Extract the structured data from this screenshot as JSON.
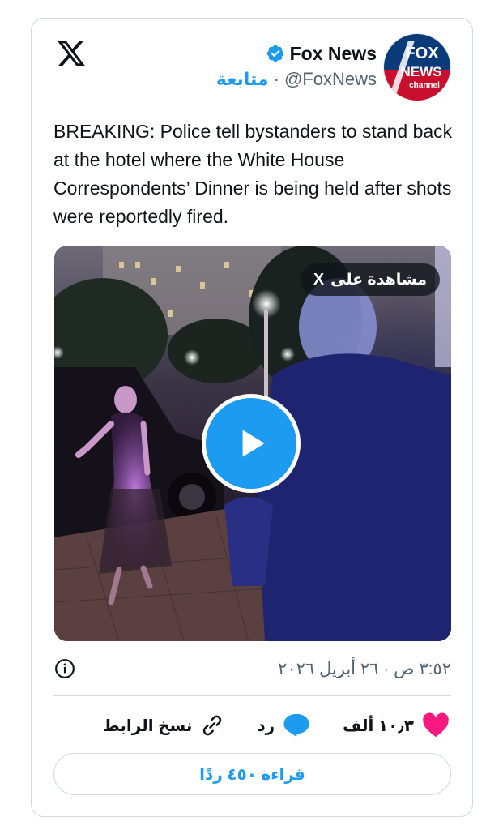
{
  "account": {
    "display_name": "Fox News",
    "handle": "@FoxNews",
    "separator": "·",
    "follow_label": "متابعة",
    "avatar_text_top": "FOX",
    "avatar_text_mid": "NEWS",
    "avatar_text_bottom": "channel"
  },
  "tweet": {
    "text": "BREAKING: Police tell bystanders to stand back at the hotel where the White House Correspondents’ Dinner is being held after shots were reportedly fired.",
    "watch_label": "مشاهدة على",
    "watch_x": "X",
    "timestamp": "٣:٥٢ ص · ٢٦ أبريل ٢٠٢٦"
  },
  "actions": {
    "likes_count": "١٠٫٣ ألف",
    "reply_label": "رد",
    "copy_link_label": "نسخ الرابط"
  },
  "read_replies_label": "قراءة ٤٥٠ ردًا",
  "colors": {
    "accent": "#1d9bf0",
    "heart": "#f91880",
    "fox_red": "#c8102e",
    "fox_blue": "#003366"
  }
}
